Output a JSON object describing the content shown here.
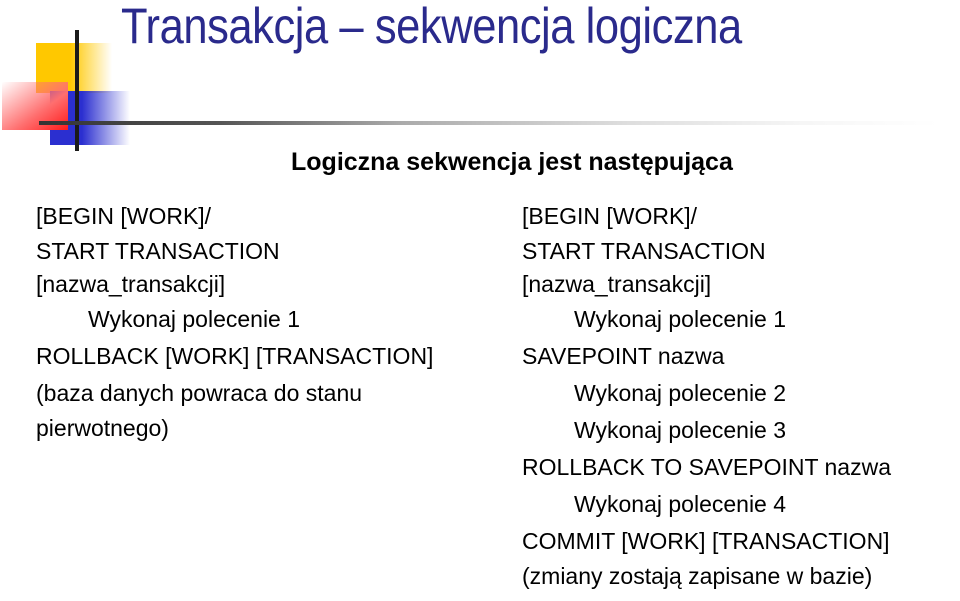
{
  "slide": {
    "title": "Transakcja – sekwencja logiczna",
    "subtitle": "Logiczna sekwencja jest następująca",
    "decoration": {
      "logo_icon": "squares-crosshair-logo",
      "colors": {
        "title": "#2a2a8c",
        "yellow": "#ffc800",
        "blue": "#2b2fd0",
        "red": "#ff1a1a",
        "line": "#333333"
      }
    },
    "left_column": {
      "lines": [
        {
          "text": "[BEGIN [WORK]/",
          "indent": false
        },
        {
          "text": "START TRANSACTION",
          "indent": false
        },
        {
          "text": "[nazwa_transakcji]",
          "indent": false
        },
        {
          "text": "Wykonaj polecenie 1",
          "indent": true
        },
        {
          "text": "ROLLBACK [WORK] [TRANSACTION]",
          "indent": false
        },
        {
          "text": "(baza danych powraca do stanu",
          "indent": false
        },
        {
          "text": "pierwotnego)",
          "indent": false
        }
      ]
    },
    "right_column": {
      "lines": [
        {
          "text": "[BEGIN [WORK]/",
          "indent": false
        },
        {
          "text": "START TRANSACTION",
          "indent": false
        },
        {
          "text": "[nazwa_transakcji]",
          "indent": false
        },
        {
          "text": "Wykonaj polecenie 1",
          "indent": true
        },
        {
          "text": "SAVEPOINT nazwa",
          "indent": false
        },
        {
          "text": "Wykonaj polecenie 2",
          "indent": true
        },
        {
          "text": "Wykonaj polecenie 3",
          "indent": true
        },
        {
          "text": "ROLLBACK TO SAVEPOINT nazwa",
          "indent": false
        },
        {
          "text": "Wykonaj polecenie 4",
          "indent": true
        },
        {
          "text": "COMMIT [WORK] [TRANSACTION]",
          "indent": false
        },
        {
          "text": "(zmiany zostają zapisane w bazie)",
          "indent": false
        }
      ]
    }
  }
}
